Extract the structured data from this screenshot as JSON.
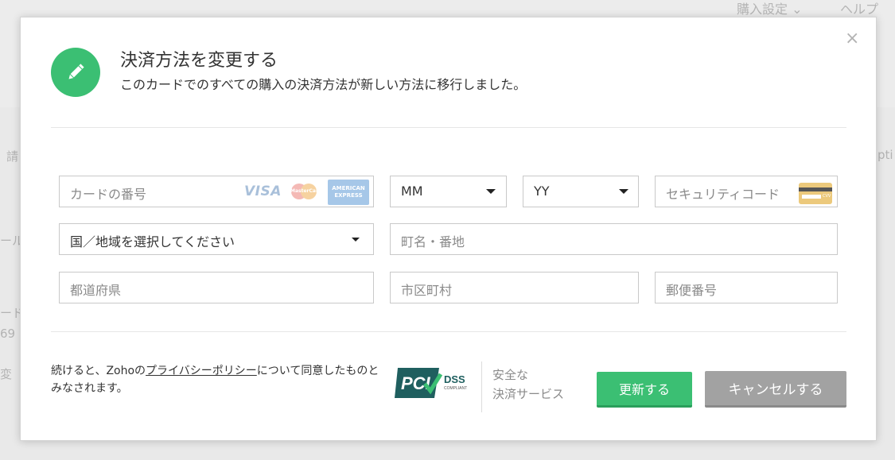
{
  "background": {
    "menu_purchase_settings": "購入設定",
    "menu_help": "ヘルプ",
    "frag_1": "請",
    "frag_2": "pti",
    "frag_3": "ール",
    "frag_4": "ード",
    "frag_5": "69",
    "frag_6": "変"
  },
  "modal": {
    "title": "決済方法を変更する",
    "subtitle": "このカードでのすべての購入の決済方法が新しい方法に移行しました。",
    "close_label": "×",
    "icon": "pencil-icon",
    "accent_color": "#3bbf73"
  },
  "form": {
    "card_number_placeholder": "カードの番号",
    "card_brands": {
      "visa": "VISA",
      "mastercard": "MasterCard",
      "amex_line1": "AMERICAN",
      "amex_line2": "EXPRESS"
    },
    "month_value": "MM",
    "year_value": "YY",
    "security_code_placeholder": "セキュリティコード",
    "country_value": "国／地域を選択してください",
    "street_placeholder": "町名・番地",
    "prefecture_placeholder": "都道府県",
    "city_placeholder": "市区町村",
    "postal_placeholder": "郵便番号"
  },
  "footer": {
    "consent_prefix": "続けると、Zohoの",
    "privacy_link": "プライバシーポリシー",
    "consent_suffix": "について同意したものとみなされます。",
    "pci_text": "PCI",
    "pci_dss_text": "DSS",
    "pci_compliant_text": "COMPLIANT",
    "secure_line1": "安全な",
    "secure_line2": "決済サービス",
    "update_button": "更新する",
    "cancel_button": "キャンセルする"
  }
}
